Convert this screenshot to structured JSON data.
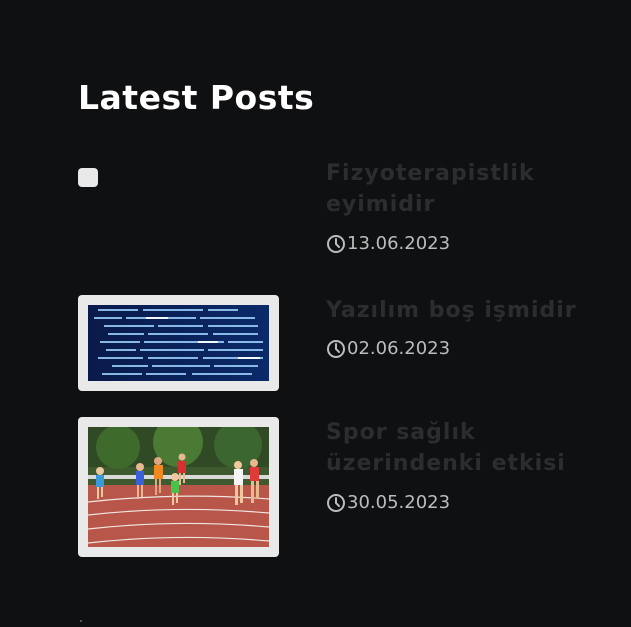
{
  "widget": {
    "title": "Latest Posts"
  },
  "posts": [
    {
      "title": "Fizyoterapistlik eyimidir",
      "date": "13.06.2023",
      "thumbnail": "broken-image"
    },
    {
      "title": "Yazılım boş işmidir",
      "date": "02.06.2023",
      "thumbnail": "code-screen-photo"
    },
    {
      "title": "Spor sağlık üzerindenki etkisi",
      "date": "30.05.2023",
      "thumbnail": "running-track-photo"
    }
  ],
  "colors": {
    "background": "#0f1012",
    "post_title": "#2c2d30",
    "date": "#bcbcbc",
    "thumb_frame": "#e9e9e9"
  }
}
